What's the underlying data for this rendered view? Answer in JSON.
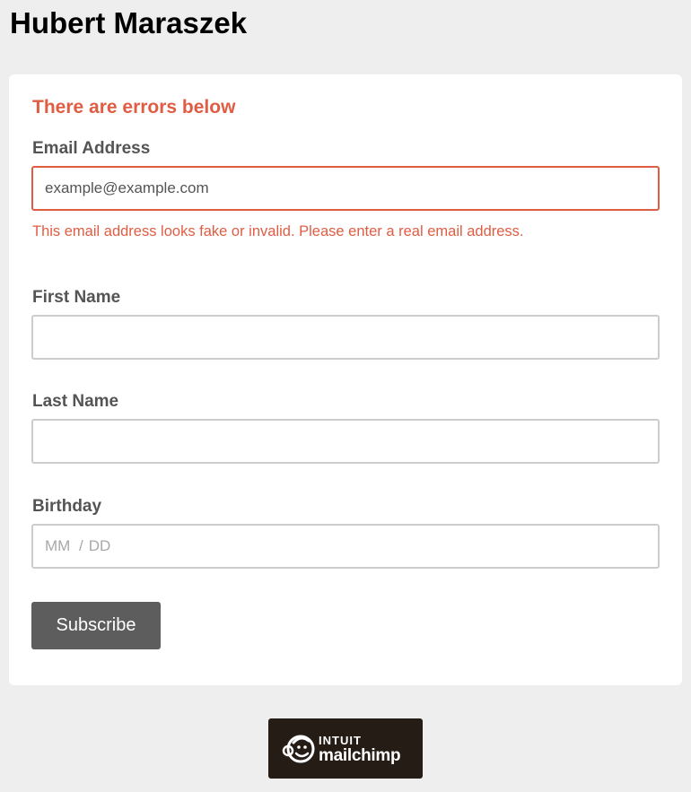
{
  "header": {
    "title": "Hubert Maraszek"
  },
  "form": {
    "error_heading": "There are errors below",
    "email": {
      "label": "Email Address",
      "value": "example@example.com",
      "error": "This email address looks fake or invalid. Please enter a real email address."
    },
    "first_name": {
      "label": "First Name",
      "value": ""
    },
    "last_name": {
      "label": "Last Name",
      "value": ""
    },
    "birthday": {
      "label": "Birthday",
      "month_placeholder": "MM",
      "separator": "/",
      "day_placeholder": "DD"
    },
    "submit_label": "Subscribe"
  },
  "footer": {
    "badge_top": "INTUIT",
    "badge_bottom": "mailchimp",
    "badge_icon": "freddie-monkey-icon"
  },
  "colors": {
    "error": "#e05d44",
    "button": "#5d5d5d",
    "badge_background": "#241c15",
    "page_background": "#eeeeee"
  }
}
